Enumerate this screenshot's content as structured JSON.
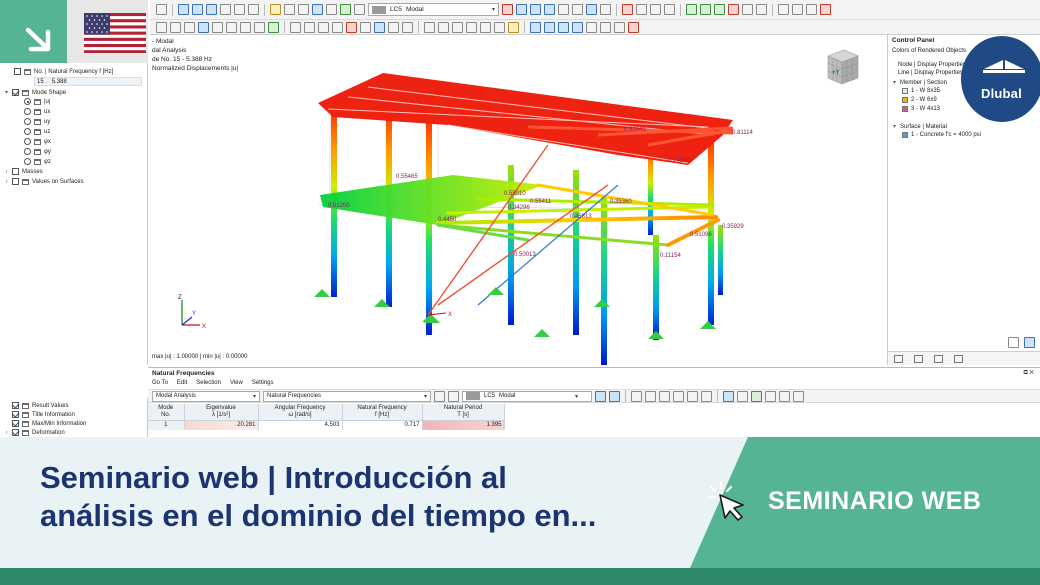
{
  "toolbar": {
    "lc_label": "LC5",
    "lc_value": "Modal"
  },
  "navigator": {
    "natural_frequency_label": "No. | Natural Frequency f [Hz]",
    "mode_no": "15",
    "mode_freq": "5.388",
    "mode_shape_label": "Mode Shape",
    "components": [
      "|u|",
      "ux",
      "uy",
      "uz",
      "φx",
      "φy",
      "φz"
    ],
    "masses_label": "Masses",
    "values_on_surfaces_label": "Values on Surfaces",
    "bottom_items": [
      "Result Values",
      "Title Information",
      "Max/Min Information",
      "Deformation"
    ]
  },
  "view": {
    "line1": "- Modal",
    "line2": "dal Analysis",
    "line3": "de No. 15 - 5.388 Hz",
    "line4": "Normalized Displacements |u|",
    "maxmin": "max |u| : 1.00000 | min |u| : 0.00000",
    "values": [
      "0.81114",
      "0.74932",
      "0.92841",
      "0.35929",
      "0.51096",
      "0.11154",
      "0.35360",
      "0.55465",
      "0.51200",
      "0.34296",
      "0.55010",
      "0.55411",
      "0.45813",
      "0.50013",
      "0.4450"
    ],
    "axis_x": "X",
    "axis_y": "Y",
    "axis_z": "Z",
    "cube_label": "+Y"
  },
  "control_panel": {
    "title": "Control Panel",
    "header": "Colors of Rendered Objects",
    "row1": "Node | Display Properties",
    "row2": "Line | Display Properties",
    "member_section": "Member | Section",
    "sections": [
      {
        "label": "1 - W 8x35",
        "color": "#cdeef6"
      },
      {
        "label": "2 - W 6x9",
        "color": "#f2b705"
      },
      {
        "label": "3 - W 4x13",
        "color": "#cf5f85"
      }
    ],
    "surface_material": "Surface | Material",
    "material": {
      "label": "1 - Concrete f'c = 4000 psi",
      "color": "#5b9bd5"
    }
  },
  "nf_panel": {
    "title": "Natural Frequencies",
    "menu": [
      "Go To",
      "Edit",
      "Selection",
      "View",
      "Settings"
    ],
    "analysis_combo": "Modal Analysis",
    "result_combo": "Natural Frequencies",
    "lc_label": "LC5",
    "lc_value": "Modal",
    "headers": [
      {
        "top": "Mode",
        "bottom": "No."
      },
      {
        "top": "Eigenvalue",
        "bottom": "λ [1/s²]"
      },
      {
        "top": "Angular Frequency",
        "bottom": "ω [rad/s]"
      },
      {
        "top": "Natural Frequency",
        "bottom": "f [Hz]"
      },
      {
        "top": "Natural Period",
        "bottom": "T [s]"
      }
    ],
    "row": {
      "mode": "1",
      "eigenvalue": "20.281",
      "angular": "4.503",
      "natural_freq": "0.717",
      "period": "1.395"
    }
  },
  "brand": {
    "logo_text": "Dlubal"
  },
  "banner": {
    "title_line1": "Seminario web | Introducción al",
    "title_line2": "análisis en el dominio del tiempo en...",
    "tag": "SEMINARIO WEB",
    "colors": {
      "navy": "#1c3470",
      "green": "#55b493",
      "dark_green": "#2f8a6c",
      "light": "#e9f3f6"
    }
  }
}
